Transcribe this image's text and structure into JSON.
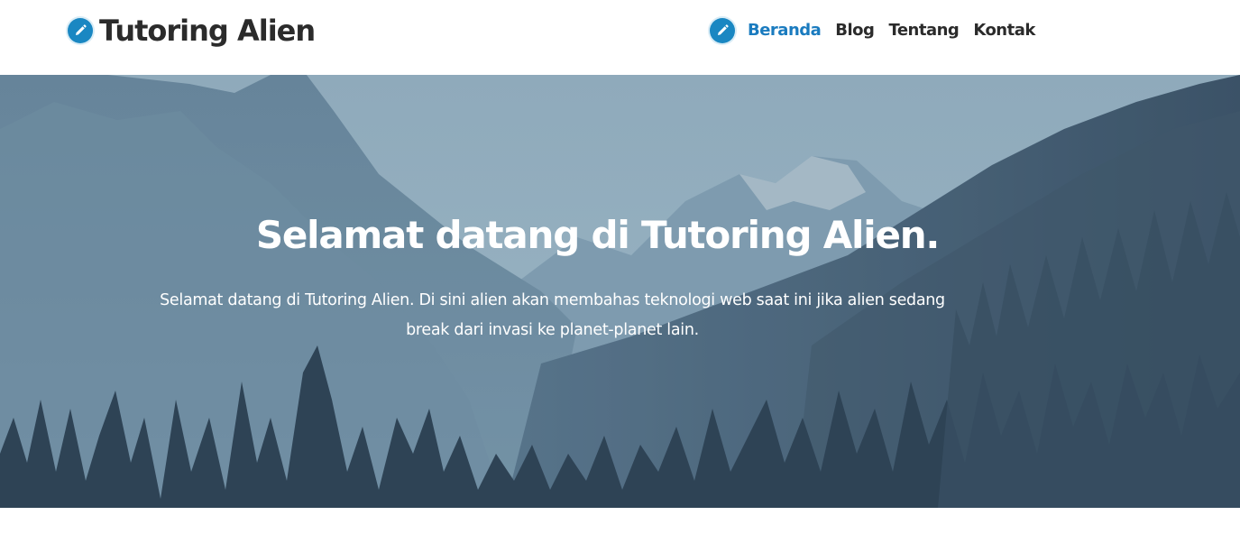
{
  "header": {
    "brand": {
      "title": "Tutoring Alien",
      "icon": "pencil-icon"
    },
    "nav": {
      "icon": "pencil-icon",
      "items": [
        {
          "label": "Beranda",
          "active": true
        },
        {
          "label": "Blog",
          "active": false
        },
        {
          "label": "Tentang",
          "active": false
        },
        {
          "label": "Kontak",
          "active": false
        }
      ]
    }
  },
  "hero": {
    "title": "Selamat datang di Tutoring Alien.",
    "text": "Selamat datang di Tutoring Alien. Di sini alien akan membahas teknologi web saat ini jika alien sedang break dari invasi ke planet-planet lain.",
    "background": "mountain-forest-landscape"
  },
  "colors": {
    "accent": "#1a87c2",
    "active_link": "#1a7bbf",
    "text_dark": "#2b2b2b",
    "hero_text": "#ffffff"
  }
}
